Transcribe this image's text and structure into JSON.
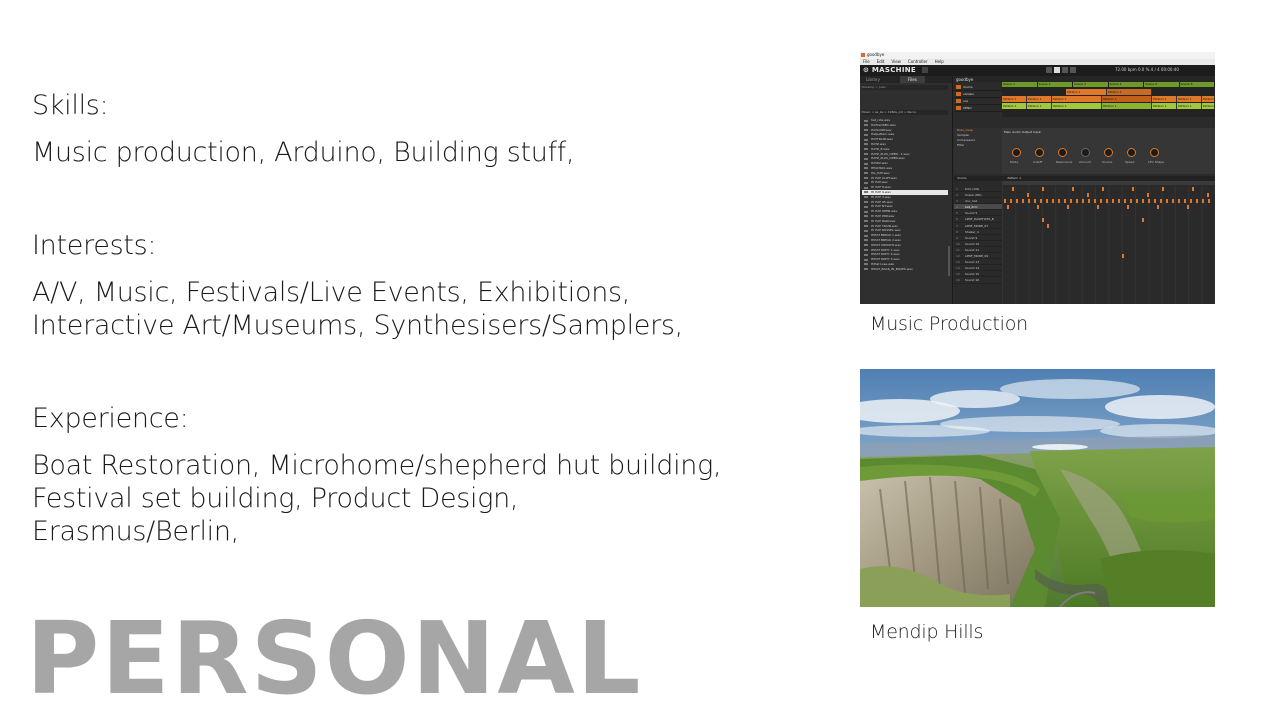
{
  "skills": {
    "heading": "Skills:",
    "body": "Music production, Arduino, Building stuff,"
  },
  "interests": {
    "heading": "Interests:",
    "body": "A/V, Music, Festivals/Live Events, Exhibitions, Interactive Art/Museums, Synthesisers/Samplers,"
  },
  "experience": {
    "heading": "Experience:",
    "body": "Boat Restoration, Microhome/shepherd hut building, Festival set building, Product Design, Erasmus/Berlin,"
  },
  "title": "PERSONAL",
  "images": [
    {
      "caption": "Music Production"
    },
    {
      "caption": "Mendip Hills"
    }
  ],
  "maschine": {
    "window_title": "goodbye",
    "menu": [
      "File",
      "Edit",
      "View",
      "Controller",
      "Help"
    ],
    "logo": "MASCHINE",
    "tempo": "72.00 bpm  0.0 %  4 / 4  00:00:40",
    "tabs": [
      "Library",
      "Files"
    ],
    "path_top": "Desktop > Jules",
    "path_browse": "Music > sa_ke > 1960s_old > Recru",
    "project_name": "goodbye",
    "groups": [
      "drums",
      "vamelo",
      "vox",
      "XEND"
    ],
    "scenes": [
      "Scene 1",
      "Scene 2",
      "Scene 3",
      "Scene 4",
      "Scene 5",
      "Scene 6"
    ],
    "clip_label": "Pattern 1",
    "plugin_side": [
      "Bass_Gesp",
      "Sampler",
      "Compressor",
      "Filter"
    ],
    "plugin_tabs": "Main   Audio Output Input",
    "knobs": [
      "Mode",
      "Cutoff",
      "Resonance",
      "Amount",
      "Source",
      "Speed",
      "LFO Shape"
    ],
    "pattern_group": "drums",
    "pattern_name": "Pattern 1",
    "files": [
      "hat_ride.wav",
      "HATCLOSED.wav",
      "HATLOOP.wav",
      "Hatpattern.wav",
      "HATTRAIN.wav",
      "HATZ.wav",
      "HATZ_8.wav",
      "HATZ_PLUS_OPEN - 1.wav",
      "HATZ_PLUS_OPEN.wav",
      "HATZ2.wav",
      "HEADS00.wav",
      "HG_HAT.wav",
      "HI HAT CLIPT.wav",
      "HI HAT.wav",
      "HI HAT 8.wav",
      "HI HAT 9.wav",
      "HI HAT 3.wav",
      "HI HAT 95.wav",
      "HI HAT NT.wav",
      "HI HAT OPEN.wav",
      "HI HAT PDP.wav",
      "HI HAT RAW.wav",
      "HI HAT TRAIN.wav",
      "HI HAT RUSSEL.wav",
      "HIHAT BREAK 1.wav",
      "HIHAT BREAK 2.wav",
      "HIHAT CRUNCH.wav",
      "HIHAT DIRTY 1.wav",
      "HIHAT DIRTY 2.wav",
      "HIHAT DIRTY 3.wav",
      "HiHat Lose.wav",
      "HIHAT_BACK_IN_BOXES.wav"
    ],
    "selected_file_index": 15,
    "sounds": [
      "Kick (1W)",
      "Snare (HD)",
      "dnc_hat",
      "hat_drm",
      "Sound 5",
      "LPNF_DASHHAT0_B",
      "LPNF_MORE_07",
      "Shaker_4",
      "Sound 9",
      "Sound 10",
      "Sound 11",
      "LPNF_MORE_09",
      "Sound 13",
      "Sound 14",
      "Sound 15",
      "Sound 16"
    ],
    "selected_sound_index": 3
  },
  "colors": {
    "title_gray": "#a6a6a6",
    "maschine_orange": "#e0782a",
    "maschine_green": "#6e9a2a"
  }
}
